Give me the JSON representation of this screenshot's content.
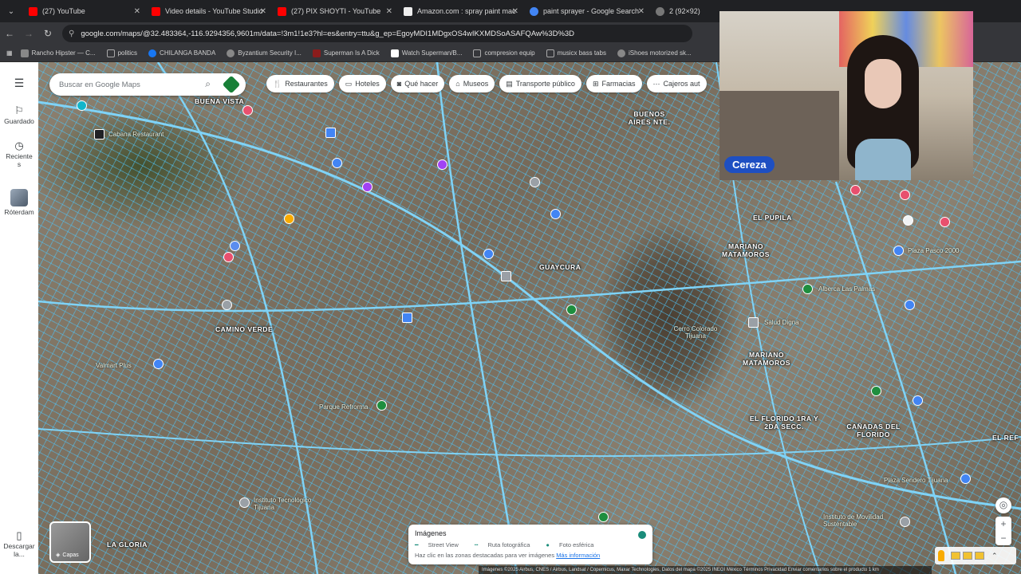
{
  "browser": {
    "tabs": [
      {
        "label": "(27) YouTube",
        "color": "#ff0000"
      },
      {
        "label": "Video details - YouTube Studio",
        "color": "#ff0000"
      },
      {
        "label": "(27) PIX SHOYTI - YouTube",
        "color": "#ff0000"
      },
      {
        "label": "Amazon.com : spray paint mac",
        "color": "#cccccc"
      },
      {
        "label": "paint sprayer - Google Search",
        "color": "#4285f4"
      },
      {
        "label": "2 (92×92)",
        "color": "#888888"
      }
    ],
    "url": "google.com/maps/@32.483364,-116.9294356,9601m/data=!3m1!1e3?hl=es&entry=ttu&g_ep=EgoyMDI1MDgxOS4wIKXMDSoASAFQAw%3D%3D",
    "bookmarks": [
      {
        "label": "Rancho Hipster — C...",
        "color": "#d0d0d0"
      },
      {
        "label": "politics",
        "color": "#d0d0d0"
      },
      {
        "label": "CHILANGA BANDA",
        "color": "#1877f2"
      },
      {
        "label": "Byzantium Security I...",
        "color": "#888888"
      },
      {
        "label": "Superman Is A Dick",
        "color": "#8a1c1c"
      },
      {
        "label": "Watch Superman/B...",
        "color": "#ffffff"
      },
      {
        "label": "compresion equip",
        "color": "#d0d0d0"
      },
      {
        "label": "musicx bass tabs",
        "color": "#d0d0d0"
      },
      {
        "label": "iShoes motorized sk...",
        "color": "#888888"
      }
    ]
  },
  "sidebar": {
    "items": [
      {
        "label": "Guardado",
        "icon": "bookmark-icon"
      },
      {
        "label": "Reciente",
        "sublabel": "s",
        "icon": "history-icon"
      },
      {
        "label": "Róterdam",
        "icon": "thumbnail"
      },
      {
        "label": "Descargar la...",
        "icon": "phone-icon"
      }
    ]
  },
  "search": {
    "placeholder": "Buscar en Google Maps"
  },
  "chips": [
    {
      "label": "Restaurantes",
      "icon": "fork-knife-icon"
    },
    {
      "label": "Hoteles",
      "icon": "bed-icon"
    },
    {
      "label": "Qué hacer",
      "icon": "camera-icon"
    },
    {
      "label": "Museos",
      "icon": "museum-icon"
    },
    {
      "label": "Transporte público",
      "icon": "bus-icon"
    },
    {
      "label": "Farmacias",
      "icon": "pharmacy-icon"
    },
    {
      "label": "Cajeros aut",
      "icon": "atm-icon"
    }
  ],
  "map_labels": [
    {
      "text": "BUENA VISTA"
    },
    {
      "text": "BUENOS AIRES NTE."
    },
    {
      "text": "EL PUPILA"
    },
    {
      "text": "MARIANO MATAMOROS"
    },
    {
      "text": "CAMINO VERDE"
    },
    {
      "text": "MARIANO MATAMOROS"
    },
    {
      "text": "EL FLORIDO 1RA Y 2DA SECC."
    },
    {
      "text": "CAÑADAS DEL FLORIDO"
    },
    {
      "text": "LA GLORIA"
    },
    {
      "text": "GUAYCURA"
    },
    {
      "text": "EL REF"
    }
  ],
  "poi_labels": [
    {
      "text": "Cabana Restaurant"
    },
    {
      "text": "Plaza Pasco 2000"
    },
    {
      "text": "Alberca Las Palmas"
    },
    {
      "text": "Plaza Sendero Tijuana"
    },
    {
      "text": "Parque Refrorma"
    },
    {
      "text": "Valmart Plus"
    },
    {
      "text": "Instituto Tecnológico Tijuana"
    },
    {
      "text": "Cerro Colorado Tijuana"
    },
    {
      "text": "Instituto de Movilidad Sustentable"
    },
    {
      "text": "Salud Digna"
    }
  ],
  "webcam": {
    "name": "Cereza"
  },
  "layers": {
    "label": "Capas"
  },
  "imagery_panel": {
    "title": "Imágenes",
    "options": [
      "Street View",
      "Ruta fotográfica",
      "Foto esférica"
    ],
    "hint": "Haz clic en las zonas destacadas para ver imágenes",
    "link": "Más información"
  },
  "attribution": "Imágenes ©2025 Airbus, CNES / Airbus, Landsat / Copernicus, Maxar Technologies, Datos del mapa ©2025 INEGI   México   Términos   Privacidad   Enviar comentarios sobre el producto   1 km"
}
